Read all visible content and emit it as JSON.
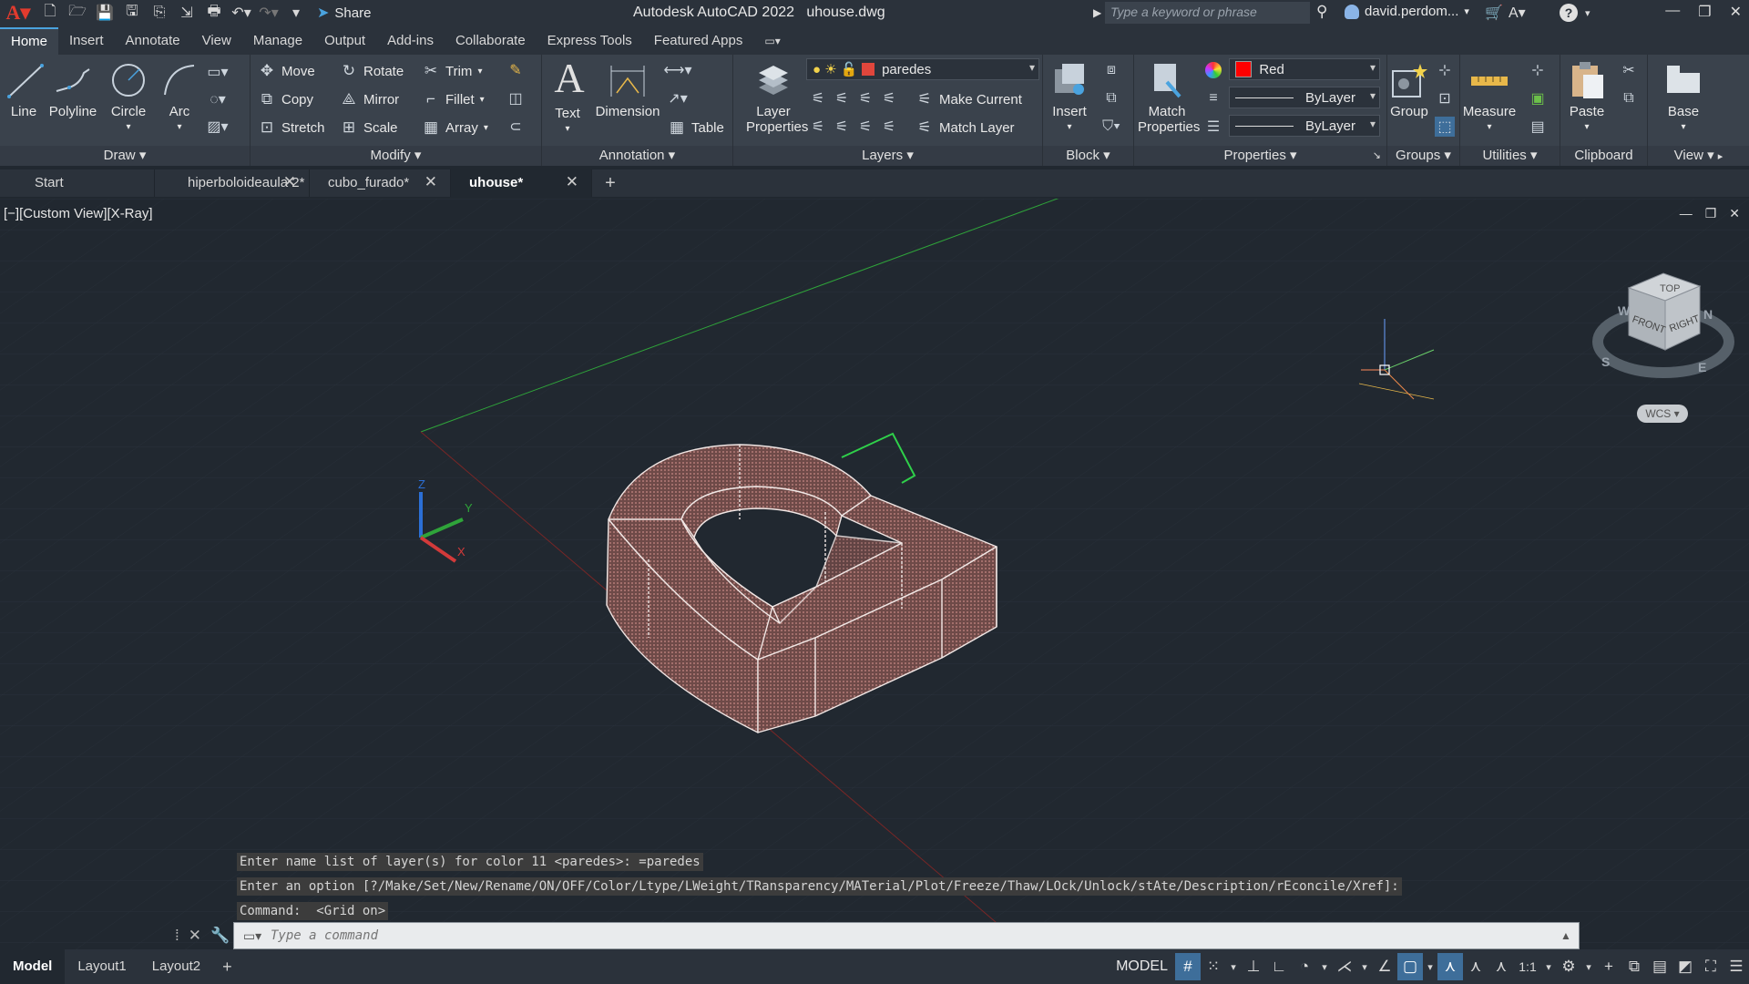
{
  "app": {
    "title": "Autodesk AutoCAD 2022",
    "file": "uhouse.dwg",
    "share_label": "Share",
    "search_placeholder": "Type a keyword or phrase",
    "user_name": "david.perdom...",
    "help": "?"
  },
  "ribbon_tabs": [
    "Home",
    "Insert",
    "Annotate",
    "View",
    "Manage",
    "Output",
    "Add-ins",
    "Collaborate",
    "Express Tools",
    "Featured Apps"
  ],
  "draw": {
    "title": "Draw",
    "line": "Line",
    "polyline": "Polyline",
    "circle": "Circle",
    "arc": "Arc"
  },
  "modify": {
    "title": "Modify",
    "move": "Move",
    "rotate": "Rotate",
    "trim": "Trim",
    "copy": "Copy",
    "mirror": "Mirror",
    "fillet": "Fillet",
    "stretch": "Stretch",
    "scale": "Scale",
    "array": "Array"
  },
  "annotation": {
    "title": "Annotation",
    "text": "Text",
    "dimension": "Dimension",
    "table": "Table"
  },
  "layers": {
    "title": "Layers",
    "layer_properties_1": "Layer",
    "layer_properties_2": "Properties",
    "current_layer": "paredes",
    "make_current": "Make Current",
    "match_layer": "Match Layer"
  },
  "block": {
    "title": "Block",
    "insert": "Insert"
  },
  "properties": {
    "title": "Properties",
    "match_1": "Match",
    "match_2": "Properties",
    "color": "Red",
    "linetype": "ByLayer",
    "lineweight": "ByLayer"
  },
  "groups": {
    "title": "Groups",
    "group": "Group"
  },
  "utilities": {
    "title": "Utilities",
    "measure": "Measure"
  },
  "clipboard": {
    "title": "Clipboard",
    "paste": "Paste"
  },
  "view": {
    "title": "View",
    "base": "Base"
  },
  "file_tabs": [
    "Start",
    "hiperboloideaula 2*",
    "cubo_furado*",
    "uhouse*"
  ],
  "viewport": {
    "label": "[−][Custom View][X-Ray]",
    "wcs": "WCS",
    "axis_x": "X",
    "axis_y": "Y",
    "axis_z": "Z"
  },
  "viewcube": {
    "top": "TOP",
    "front": "FRONT",
    "right": "RIGHT",
    "n": "N",
    "s": "S",
    "e": "E",
    "w": "W"
  },
  "command_history": [
    "Enter name list of layer(s) for color 11 <paredes>: =paredes",
    "Enter an option [?/Make/Set/New/Rename/ON/OFF/Color/Ltype/LWeight/TRansparency/MATerial/Plot/Freeze/Thaw/LOck/Unlock/stAte/Description/rEconcile/Xref]:",
    "Command:  <Grid on>"
  ],
  "command_placeholder": "Type a command",
  "layout_tabs": [
    "Model",
    "Layout1",
    "Layout2"
  ],
  "status": {
    "model": "MODEL",
    "scale": "1:1"
  },
  "colors": {
    "accent": "#4aa3df",
    "object": "#c98a85",
    "layer_swatch": "#e0463c",
    "color_red": "#ff0000"
  }
}
